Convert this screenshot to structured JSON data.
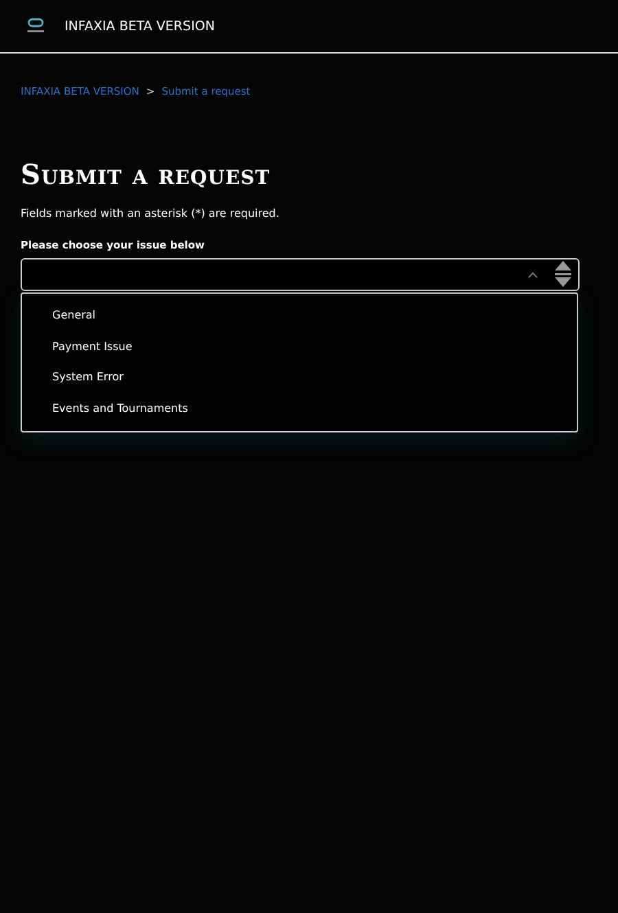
{
  "header": {
    "title": "INFAXIA BETA VERSION"
  },
  "breadcrumbs": [
    {
      "label": "INFAXIA BETA VERSION",
      "separator": ">"
    },
    {
      "label": "Submit a request"
    }
  ],
  "heading": "Submit a request",
  "note": "Fields marked with an asterisk (*) are required.",
  "select": {
    "label": "Please choose your issue below",
    "expanded": true,
    "options": [
      {
        "label": "General"
      },
      {
        "label": "Payment Issue"
      },
      {
        "label": "System Error"
      },
      {
        "label": "Events and Tournaments"
      }
    ]
  }
}
